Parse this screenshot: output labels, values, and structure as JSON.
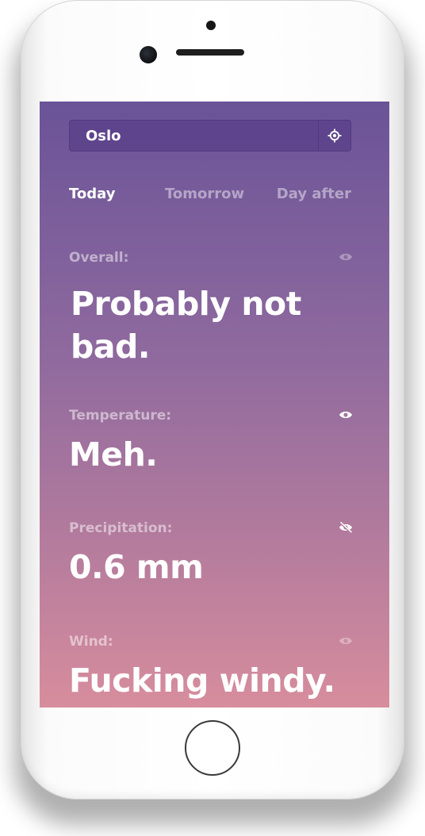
{
  "search": {
    "value": "Oslo",
    "locate_icon": "crosshair-icon"
  },
  "tabs": [
    {
      "label": "Today",
      "active": true
    },
    {
      "label": "Tomorrow",
      "active": false
    },
    {
      "label": "Day after",
      "active": false
    }
  ],
  "sections": {
    "overall": {
      "label": "Overall:",
      "value": "Probably not bad.",
      "visibility_icon": "eye-icon",
      "icon_state": "dim"
    },
    "temperature": {
      "label": "Temperature:",
      "value": "Meh.",
      "visibility_icon": "eye-icon",
      "icon_state": "bright"
    },
    "precipitation": {
      "label": "Precipitation:",
      "value": "0.6 mm",
      "visibility_icon": "eye-off-icon",
      "icon_state": "bright"
    },
    "wind": {
      "label": "Wind:",
      "value": "Fucking windy.",
      "visibility_icon": "eye-icon",
      "icon_state": "dim"
    }
  },
  "colors": {
    "gradient_top": "#6a5398",
    "gradient_bottom": "#d78d9d",
    "text_active": "#ffffff",
    "text_muted": "rgba(255,255,255,0.45)"
  }
}
